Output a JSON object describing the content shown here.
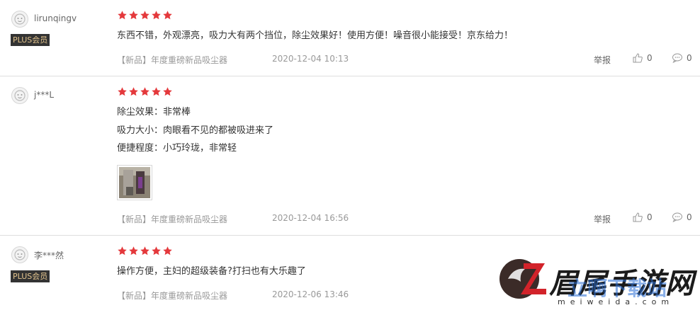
{
  "reviews": [
    {
      "username": "lirunqingv",
      "badge": "PLUS会员",
      "lines": [
        "东西不错，外观漂亮，吸力大有两个挡位，除尘效果好！使用方便！噪音很小能接受！京东给力！"
      ],
      "product": "【新品】年度重磅新品吸尘器",
      "date": "2020-12-04 10:13",
      "report": "举报",
      "likes": "0",
      "comments": "0"
    },
    {
      "username": "j***L",
      "lines": [
        "除尘效果：非常棒",
        "吸力大小：肉眼看不见的都被吸进来了",
        "便捷程度：小巧玲珑，非常轻"
      ],
      "product": "【新品】年度重磅新品吸尘器",
      "date": "2020-12-04 16:56",
      "report": "举报",
      "likes": "0",
      "comments": "0"
    },
    {
      "username": "李***然",
      "badge": "PLUS会员",
      "lines": [
        "操作方便，主妇的超级装备?打扫也有大乐趣了"
      ],
      "product": "【新品】年度重磅新品吸尘器",
      "date": "2020-12-06 13:46"
    }
  ],
  "watermark": {
    "title": "眉尾手游网",
    "overlay": "立啊下载站",
    "url": "meiweida.com"
  },
  "colors": {
    "star": "#e4393c",
    "badge_bg": "#333333",
    "badge_text": "#e2c48e"
  }
}
